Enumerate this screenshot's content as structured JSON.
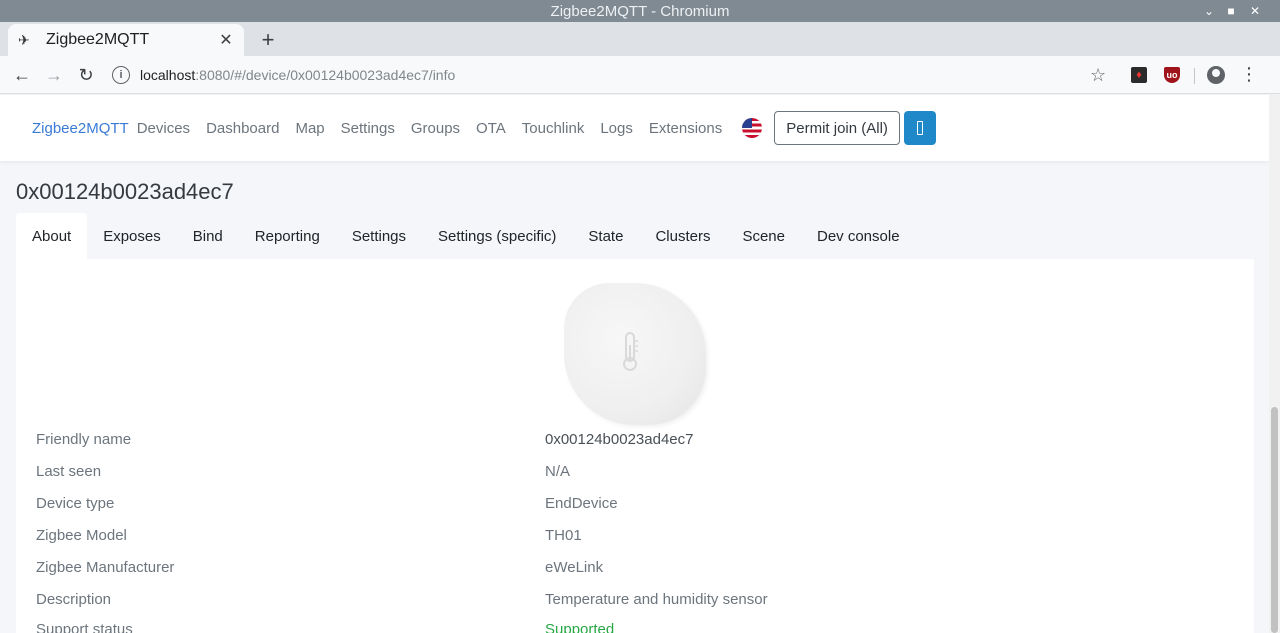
{
  "window": {
    "title": "Zigbee2MQTT - Chromium"
  },
  "browser": {
    "tab_title": "Zigbee2MQTT",
    "url_host": "localhost",
    "url_path": ":8080/#/device/0x00124b0023ad4ec7/info"
  },
  "nav": {
    "brand": "Zigbee2MQTT",
    "links": [
      "Devices",
      "Dashboard",
      "Map",
      "Settings",
      "Groups",
      "OTA",
      "Touchlink",
      "Logs",
      "Extensions"
    ],
    "permit_join": "Permit join (All)"
  },
  "device": {
    "title": "0x00124b0023ad4ec7",
    "tabs": [
      "About",
      "Exposes",
      "Bind",
      "Reporting",
      "Settings",
      "Settings (specific)",
      "State",
      "Clusters",
      "Scene",
      "Dev console"
    ],
    "info": [
      {
        "label": "Friendly name",
        "value": "0x00124b0023ad4ec7"
      },
      {
        "label": "Last seen",
        "value": "N/A"
      },
      {
        "label": "Device type",
        "value": "EndDevice"
      },
      {
        "label": "Zigbee Model",
        "value": "TH01"
      },
      {
        "label": "Zigbee Manufacturer",
        "value": "eWeLink"
      },
      {
        "label": "Description",
        "value": "Temperature and humidity sensor"
      },
      {
        "label": "Support status",
        "value": "Supported"
      }
    ]
  },
  "colors": {
    "brand": "#3a7bd5",
    "permit_toggle": "#1e88c9",
    "supported": "#28a745"
  }
}
